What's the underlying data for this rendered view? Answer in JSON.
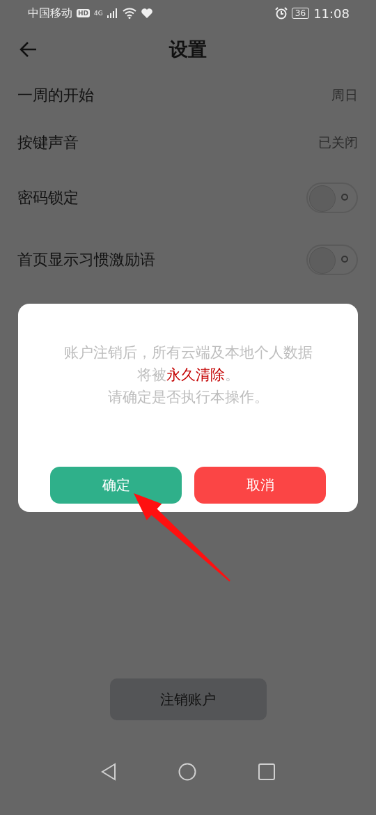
{
  "status_bar": {
    "carrier": "中国移动",
    "hd_badge": "HD",
    "network": "4G",
    "battery": "36",
    "time": "11:08"
  },
  "header": {
    "title": "设置"
  },
  "settings": [
    {
      "kind": "value",
      "label": "一周的开始",
      "value": "周日"
    },
    {
      "kind": "value",
      "label": "按键声音",
      "value": "已关闭"
    },
    {
      "kind": "toggle",
      "label": "密码锁定",
      "on": false
    },
    {
      "kind": "toggle",
      "label": "首页显示习惯激励语",
      "on": false
    }
  ],
  "dialog": {
    "message": [
      [
        {
          "text": "账户注销后，所有云端及本地个人数据",
          "emphasis": false
        }
      ],
      [
        {
          "text": "将被",
          "emphasis": false
        },
        {
          "text": "永久清除",
          "emphasis": true
        },
        {
          "text": "。",
          "emphasis": false
        }
      ],
      [
        {
          "text": "请确定是否执行本操作。",
          "emphasis": false
        }
      ]
    ],
    "buttons": [
      {
        "kind": "confirm",
        "label": "确定"
      },
      {
        "kind": "cancel",
        "label": "取消"
      }
    ]
  },
  "delete_account_button": "注销账户"
}
